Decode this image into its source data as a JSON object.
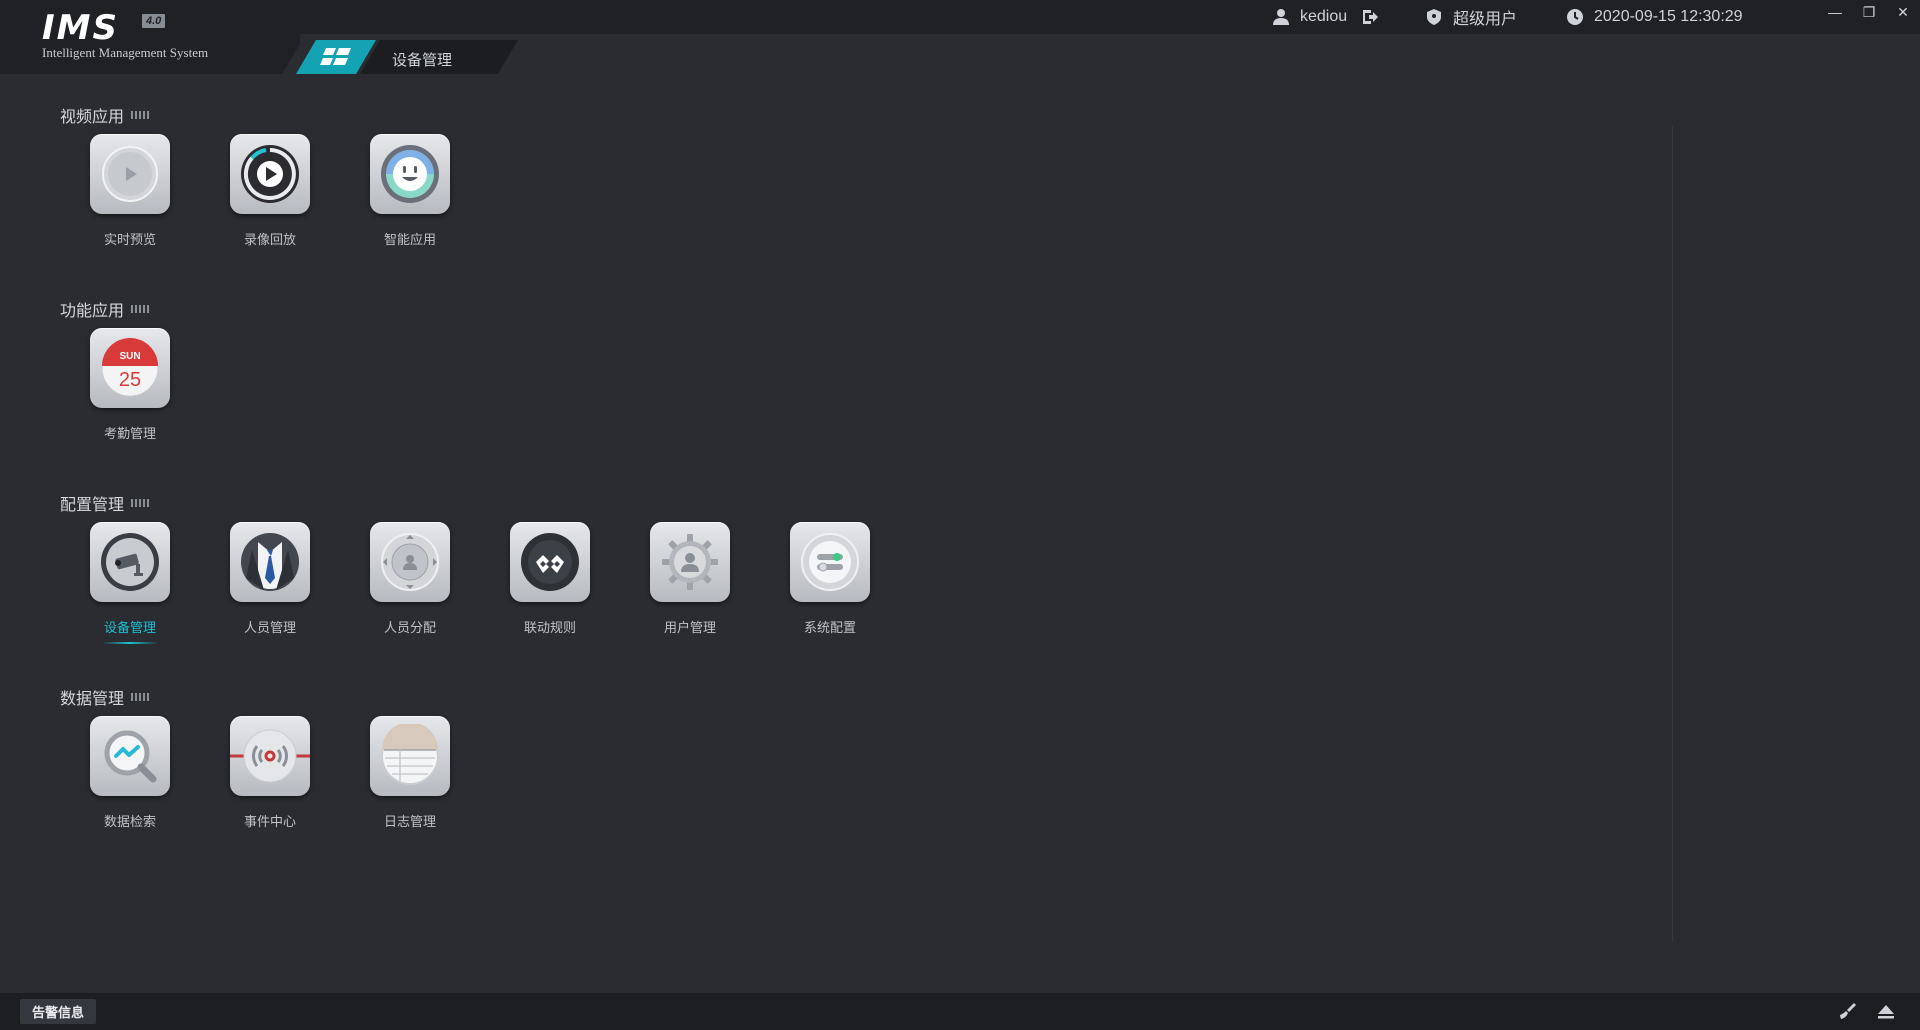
{
  "app": {
    "logo": "IMS",
    "version": "4.0",
    "subtitle": "Intelligent Management System"
  },
  "tab": {
    "label": "设备管理"
  },
  "header": {
    "username": "kediou",
    "role": "超级用户",
    "datetime": "2020-09-15 12:30:29"
  },
  "window_controls": {
    "minimize": "—",
    "restore": "❐",
    "close": "✕"
  },
  "sections": [
    {
      "title": "视频应用",
      "apps": [
        {
          "label": "实时预览",
          "icon": "play-icon"
        },
        {
          "label": "录像回放",
          "icon": "playback-icon"
        },
        {
          "label": "智能应用",
          "icon": "smart-face-icon"
        }
      ]
    },
    {
      "title": "功能应用",
      "apps": [
        {
          "label": "考勤管理",
          "icon": "calendar-icon",
          "calendar_day": "SUN",
          "calendar_date": "25"
        }
      ]
    },
    {
      "title": "配置管理",
      "apps": [
        {
          "label": "设备管理",
          "icon": "camera-icon",
          "active": true
        },
        {
          "label": "人员管理",
          "icon": "person-tie-icon"
        },
        {
          "label": "人员分配",
          "icon": "person-assign-icon"
        },
        {
          "label": "联动规则",
          "icon": "link-icon"
        },
        {
          "label": "用户管理",
          "icon": "user-gear-icon"
        },
        {
          "label": "系统配置",
          "icon": "settings-toggle-icon"
        }
      ]
    },
    {
      "title": "数据管理",
      "apps": [
        {
          "label": "数据检索",
          "icon": "data-search-icon"
        },
        {
          "label": "事件中心",
          "icon": "event-center-icon"
        },
        {
          "label": "日志管理",
          "icon": "log-icon"
        }
      ]
    }
  ],
  "footer": {
    "alarm_label": "告警信息"
  },
  "colors": {
    "accent": "#13a3b3",
    "active_text": "#1ec0d0",
    "background": "#2a2c31"
  }
}
